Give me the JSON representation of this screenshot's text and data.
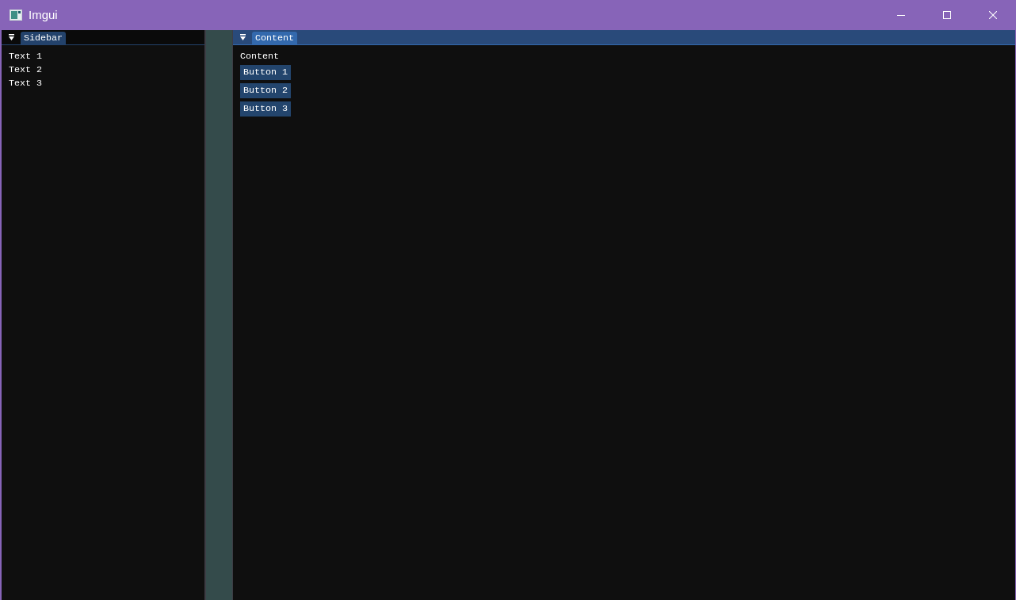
{
  "window": {
    "title": "Imgui"
  },
  "panels": [
    {
      "tab": {
        "label": "Sidebar",
        "selected": false
      },
      "items": [
        {
          "kind": "text",
          "label": "Text 1"
        },
        {
          "kind": "text",
          "label": "Text 2"
        },
        {
          "kind": "text",
          "label": "Text 3"
        }
      ]
    },
    {
      "tab": {
        "label": "Content",
        "selected": true
      },
      "items": [
        {
          "kind": "text",
          "label": "Content"
        },
        {
          "kind": "button",
          "label": "Button 1"
        },
        {
          "kind": "button",
          "label": "Button 2"
        },
        {
          "kind": "button",
          "label": "Button 3"
        }
      ]
    }
  ]
}
